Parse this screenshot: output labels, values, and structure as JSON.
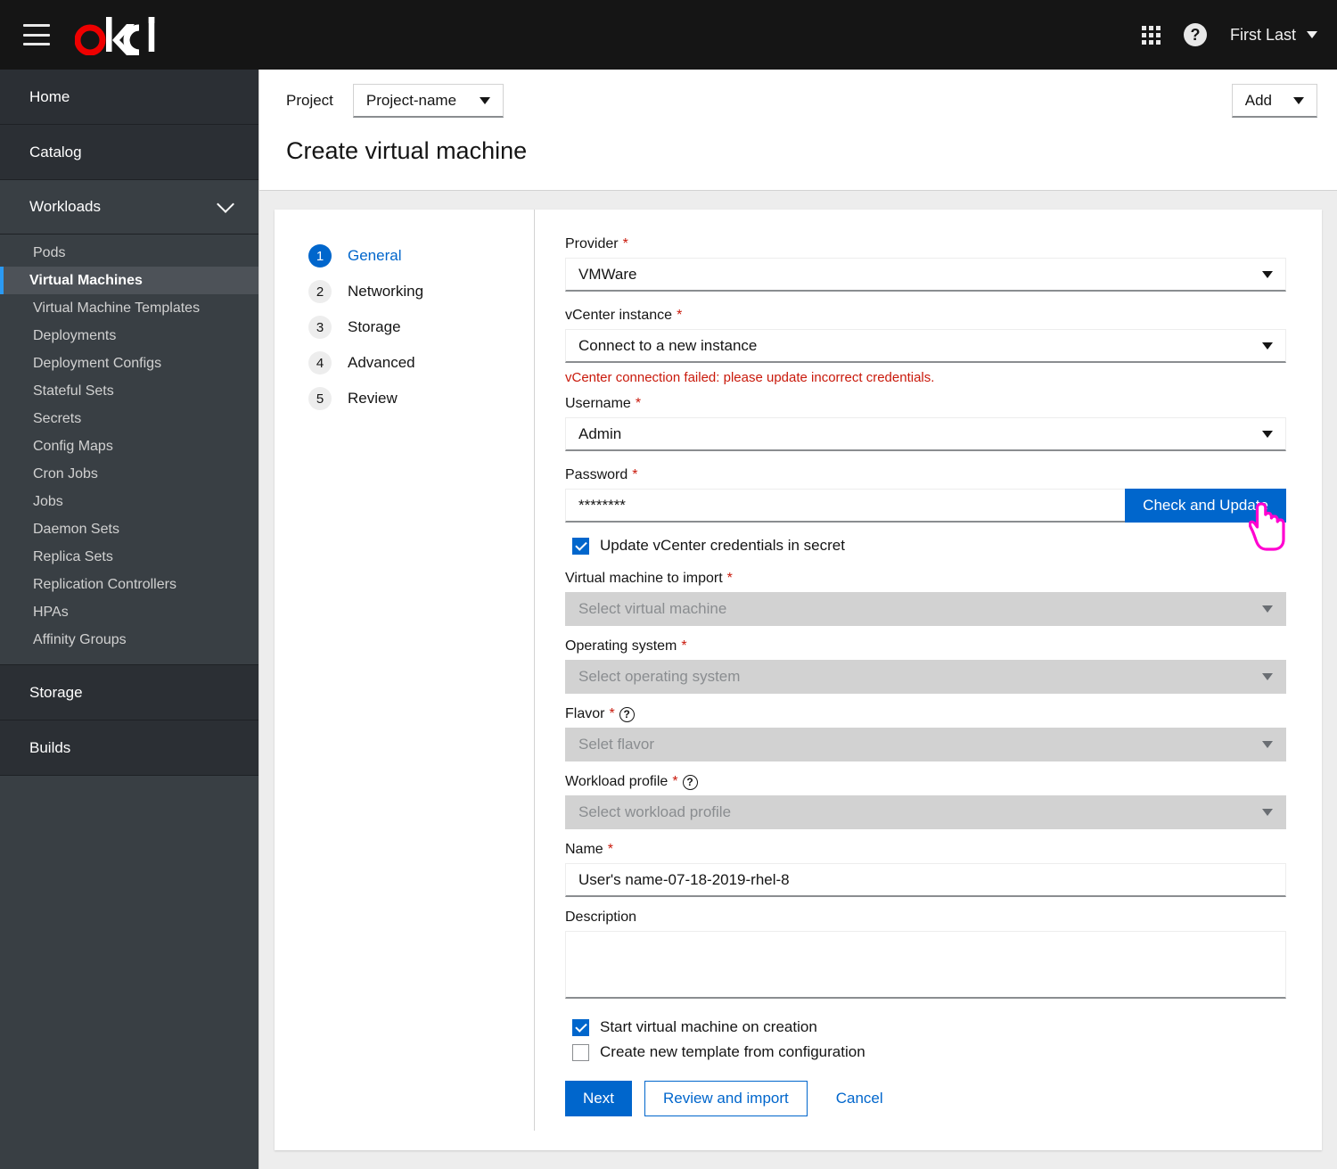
{
  "masthead": {
    "logo_text": "okd",
    "logo_accent_color": "#e00",
    "menu_icon": "hamburger-icon",
    "apps_icon": "grid-apps-icon",
    "help_icon": "help-circle-icon",
    "help_glyph": "?",
    "user_name": "First Last"
  },
  "project_bar": {
    "label": "Project",
    "selected_project": "Project-name",
    "add_label": "Add"
  },
  "page": {
    "title": "Create virtual machine"
  },
  "sidebar": {
    "sections": [
      {
        "label": "Home",
        "type": "solo"
      },
      {
        "label": "Catalog",
        "type": "solo"
      },
      {
        "label": "Workloads",
        "type": "expandable",
        "expanded": true,
        "items": [
          {
            "label": "Pods",
            "active": false
          },
          {
            "label": "Virtual Machines",
            "active": true
          },
          {
            "label": "Virtual Machine Templates",
            "active": false
          },
          {
            "label": "Deployments",
            "active": false
          },
          {
            "label": "Deployment Configs",
            "active": false
          },
          {
            "label": "Stateful Sets",
            "active": false
          },
          {
            "label": "Secrets",
            "active": false
          },
          {
            "label": "Config Maps",
            "active": false
          },
          {
            "label": "Cron Jobs",
            "active": false
          },
          {
            "label": "Jobs",
            "active": false
          },
          {
            "label": "Daemon Sets",
            "active": false
          },
          {
            "label": "Replica Sets",
            "active": false
          },
          {
            "label": "Replication Controllers",
            "active": false
          },
          {
            "label": "HPAs",
            "active": false
          },
          {
            "label": "Affinity Groups",
            "active": false
          }
        ]
      },
      {
        "label": "Storage",
        "type": "solo"
      },
      {
        "label": "Builds",
        "type": "solo"
      }
    ],
    "active_item": "Virtual Machines",
    "accent_color": "#2b9af3"
  },
  "wizard": {
    "steps": [
      {
        "num": "1",
        "label": "General",
        "active": true
      },
      {
        "num": "2",
        "label": "Networking",
        "active": false
      },
      {
        "num": "3",
        "label": "Storage",
        "active": false
      },
      {
        "num": "4",
        "label": "Advanced",
        "active": false
      },
      {
        "num": "5",
        "label": "Review",
        "active": false
      }
    ],
    "active_color": "#0066cc"
  },
  "form": {
    "provider": {
      "label": "Provider",
      "required": true,
      "value": "VMWare",
      "disabled": false
    },
    "vcenter_instance": {
      "label": "vCenter instance",
      "required": true,
      "value": "Connect to a new instance",
      "disabled": false
    },
    "vcenter_error": "vCenter connection failed: please update incorrect credentials.",
    "username": {
      "label": "Username",
      "required": true,
      "value": "Admin",
      "disabled": false
    },
    "password": {
      "label": "Password",
      "required": true,
      "value": "********",
      "disabled": false
    },
    "check_update_button": "Check and Update",
    "update_credentials_checkbox": {
      "label": "Update vCenter credentials in secret",
      "checked": true
    },
    "vm_to_import": {
      "label": "Virtual machine to import",
      "required": true,
      "placeholder": "Select virtual machine",
      "disabled": true
    },
    "operating_system": {
      "label": "Operating system",
      "required": true,
      "placeholder": "Select operating system",
      "disabled": true
    },
    "flavor": {
      "label": "Flavor",
      "required": true,
      "placeholder": "Selet flavor",
      "disabled": true,
      "has_help": true
    },
    "workload_profile": {
      "label": "Workload profile",
      "required": true,
      "placeholder": "Select workload profile",
      "disabled": true,
      "has_help": true
    },
    "name": {
      "label": "Name",
      "required": true,
      "value": "User's name-07-18-2019-rhel-8",
      "disabled": false
    },
    "description": {
      "label": "Description",
      "required": false,
      "value": "",
      "disabled": false
    },
    "start_vm_checkbox": {
      "label": "Start virtual machine on creation",
      "checked": true
    },
    "create_template_checkbox": {
      "label": "Create new template from configuration",
      "checked": false
    },
    "required_marker": "*",
    "error_color": "#c9190b"
  },
  "actions": {
    "next": "Next",
    "review_and_import": "Review and import",
    "cancel": "Cancel"
  },
  "cursor": {
    "type": "pointing-hand-cursor",
    "outline_color": "#ff00d0"
  }
}
